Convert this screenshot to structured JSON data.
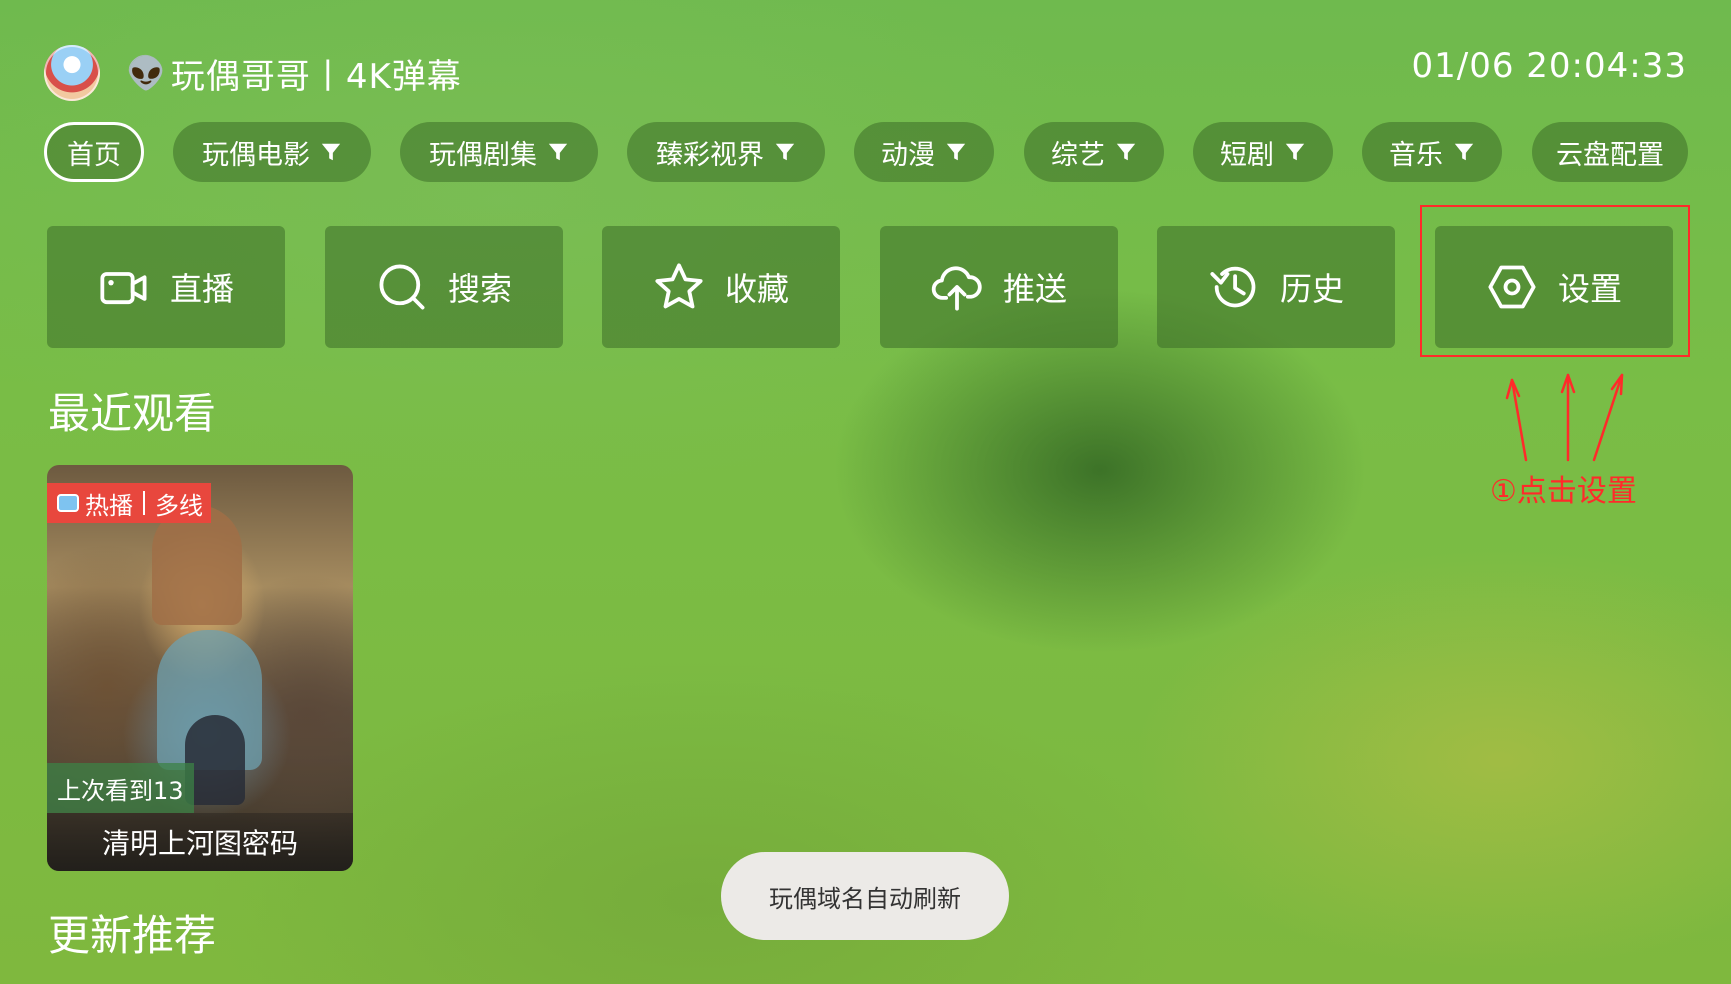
{
  "header": {
    "title_emoji": "👽",
    "title": "玩偶哥哥丨4K弹幕",
    "clock": "01/06 20:04:33"
  },
  "nav": {
    "items": [
      {
        "label": "首页",
        "filter": false,
        "active": true
      },
      {
        "label": "玩偶电影",
        "filter": true
      },
      {
        "label": "玩偶剧集",
        "filter": true
      },
      {
        "label": "臻彩视界",
        "filter": true
      },
      {
        "label": "动漫",
        "filter": true
      },
      {
        "label": "综艺",
        "filter": true
      },
      {
        "label": "短剧",
        "filter": true
      },
      {
        "label": "音乐",
        "filter": true
      },
      {
        "label": "云盘配置",
        "filter": false
      }
    ],
    "filter_icon": "filter-icon"
  },
  "actions": [
    {
      "label": "直播",
      "icon": "video-camera-icon"
    },
    {
      "label": "搜索",
      "icon": "search-icon"
    },
    {
      "label": "收藏",
      "icon": "star-icon"
    },
    {
      "label": "推送",
      "icon": "cloud-upload-icon"
    },
    {
      "label": "历史",
      "icon": "history-icon"
    },
    {
      "label": "设置",
      "icon": "settings-icon"
    }
  ],
  "annotation": {
    "text": "①点击设置",
    "color": "#ff2a2a"
  },
  "sections": {
    "recent_title": "最近观看",
    "updates_title": "更新推荐"
  },
  "recent": [
    {
      "badge_left": "热播",
      "badge_right": "多线",
      "progress": "上次看到13",
      "title": "清明上河图密码"
    }
  ],
  "toast": {
    "text": "玩偶域名自动刷新"
  }
}
